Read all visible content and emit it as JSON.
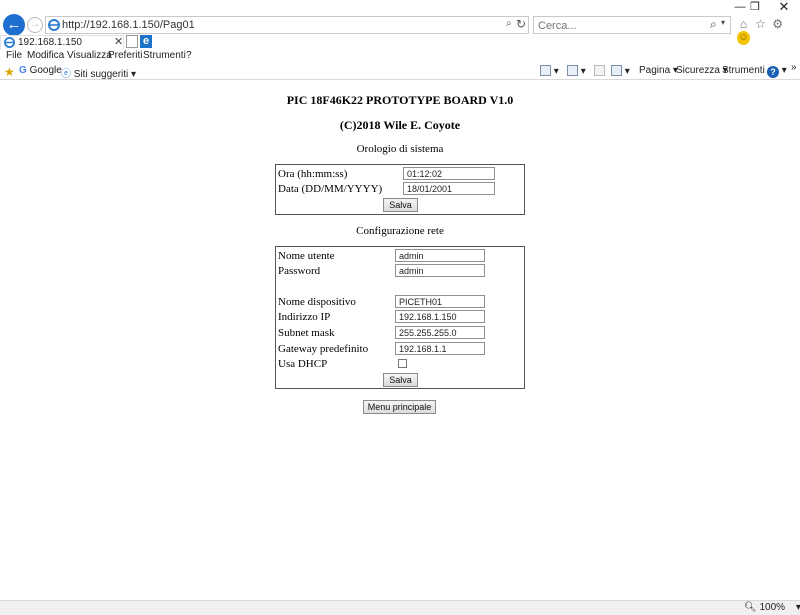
{
  "window": {
    "minimize_glyph": "—",
    "maximize_glyph": "❐",
    "close_glyph": "✕"
  },
  "address_bar": {
    "url": "http://192.168.1.150/Pag01",
    "search_glyph": "⌕",
    "refresh_glyph": "↻"
  },
  "search_bar": {
    "placeholder": "Cerca...",
    "search_glyph": "⌕",
    "dropdown_glyph": "▾"
  },
  "toolbar_icons": [
    "home-icon",
    "favorites-star-icon",
    "settings-gear-icon",
    "feedback-smiley-icon"
  ],
  "tabs": [
    {
      "label": "192.168.1.150",
      "close_glyph": "✕"
    }
  ],
  "menu": [
    "File",
    "Modifica",
    "Visualizza",
    "Preferiti",
    "Strumenti",
    "?"
  ],
  "favorites_bar": {
    "items": [
      {
        "label": "Google",
        "icon": "google-icon"
      },
      {
        "label": "Siti suggeriti ▾",
        "icon": "ie-icon"
      }
    ],
    "commands": [
      {
        "label": "Pagina ▾"
      },
      {
        "label": "Sicurezza ▾"
      },
      {
        "label": "Strumenti ▾"
      }
    ],
    "overflow_glyph": "»"
  },
  "page": {
    "title": "PIC 18F46K22 PROTOTYPE BOARD V1.0",
    "copyright": "(C)2018 Wile E. Coyote",
    "clock": {
      "heading": "Orologio di sistema",
      "time_label": "Ora (hh:mm:ss)",
      "time_value": "01:12:02",
      "date_label": "Data (DD/MM/YYYY)",
      "date_value": "18/01/2001",
      "save_label": "Salva"
    },
    "network": {
      "heading": "Configurazione rete",
      "username_label": "Nome utente",
      "username_value": "admin",
      "password_label": "Password",
      "password_value": "admin",
      "device_name_label": "Nome dispositivo",
      "device_name_value": "PICETH01",
      "ip_label": "Indirizzo IP",
      "ip_value": "192.168.1.150",
      "subnet_label": "Subnet mask",
      "subnet_value": "255.255.255.0",
      "gateway_label": "Gateway predefinito",
      "gateway_value": "192.168.1.1",
      "dhcp_label": "Usa DHCP",
      "dhcp_checked": false,
      "save_label": "Salva"
    },
    "main_menu_label": "Menu principale"
  },
  "status_bar": {
    "zoom": "100%",
    "zoom_dropdown_glyph": "▾"
  }
}
